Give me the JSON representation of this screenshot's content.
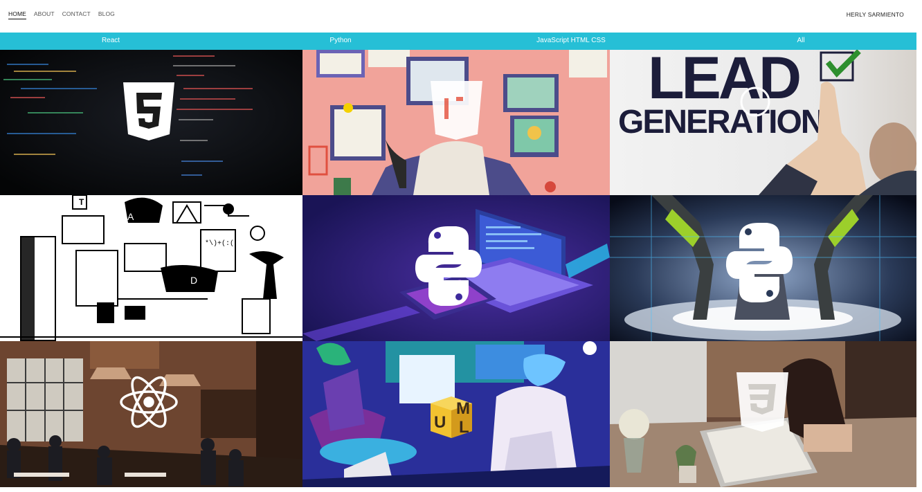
{
  "nav": {
    "items": [
      {
        "label": "HOME",
        "active": true
      },
      {
        "label": "ABOUT",
        "active": false
      },
      {
        "label": "CONTACT",
        "active": false
      },
      {
        "label": "BLOG",
        "active": false
      }
    ],
    "brand": "HERLY SARMIENTO"
  },
  "categories": {
    "react": "React",
    "python": "Python",
    "jshtmlcss": "JavaScript HTML CSS",
    "all": "All"
  },
  "colors": {
    "accent": "#26bfd6",
    "nav_text": "#555555",
    "brand_text": "#222222"
  },
  "gallery": {
    "tiles": [
      {
        "icon": "html5-icon"
      },
      {
        "icon": "js-icon"
      },
      {
        "lead": "LEAD",
        "gen": "GENERATION",
        "icon": "checkmark-icon"
      },
      {
        "bubble": "A",
        "tag": "D",
        "code": "*\\)+(:("
      },
      {
        "icon": "python-icon"
      },
      {
        "icon": "python-icon"
      },
      {
        "icon": "react-icon"
      },
      {
        "letters": [
          "U",
          "M",
          "L"
        ]
      },
      {
        "icon": "css3-icon"
      }
    ]
  }
}
